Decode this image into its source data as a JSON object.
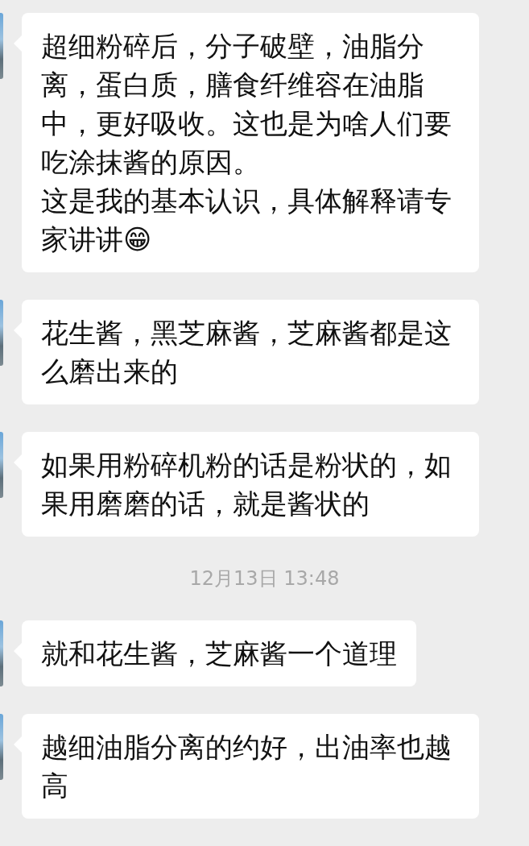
{
  "chat": [
    {
      "kind": "message",
      "paragraphs": [
        "超细粉碎后，分子破壁，油脂分离，蛋白质，膳食纤维容在油脂中，更好吸收。这也是为啥人们要吃涂抹酱的原因。",
        "这是我的基本认识，具体解释请专家讲讲😁"
      ]
    },
    {
      "kind": "message",
      "paragraphs": [
        "花生酱，黑芝麻酱，芝麻酱都是这么磨出来的"
      ]
    },
    {
      "kind": "message",
      "paragraphs": [
        "如果用粉碎机粉的话是粉状的，如果用磨磨的话，就是酱状的"
      ]
    },
    {
      "kind": "time",
      "text": "12月13日 13:48"
    },
    {
      "kind": "message",
      "paragraphs": [
        "就和花生酱，芝麻酱一个道理"
      ]
    },
    {
      "kind": "message",
      "paragraphs": [
        "越细油脂分离的约好，出油率也越高"
      ]
    }
  ]
}
